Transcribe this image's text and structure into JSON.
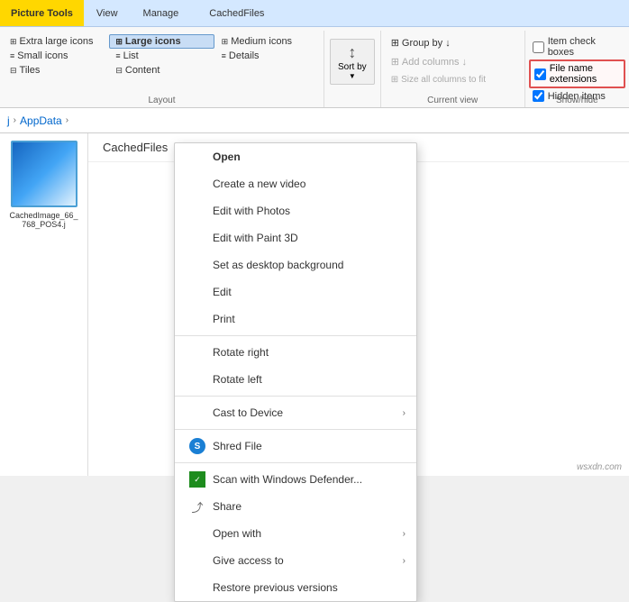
{
  "titleBar": {
    "pictureTools": "Picture Tools",
    "tabs": [
      "View",
      "Manage"
    ],
    "cachedFiles": "CachedFiles"
  },
  "ribbon": {
    "layout": {
      "label": "Layout",
      "items": [
        {
          "id": "extra-large",
          "label": "Extra large icons",
          "active": false
        },
        {
          "id": "large-icons",
          "label": "Large icons",
          "active": true
        },
        {
          "id": "medium-icons",
          "label": "Medium icons",
          "active": false
        },
        {
          "id": "small-icons",
          "label": "Small icons",
          "active": false
        },
        {
          "id": "list",
          "label": "List",
          "active": false
        },
        {
          "id": "details",
          "label": "Details",
          "active": false
        },
        {
          "id": "tiles",
          "label": "Tiles",
          "active": false
        },
        {
          "id": "content",
          "label": "Content",
          "active": false
        }
      ]
    },
    "currentView": {
      "label": "Current view",
      "sortBy": "Sort by",
      "groupBy": "Group by ↓",
      "addColumns": "Add columns ↓",
      "sizeAllColumns": "Size all columns to fit"
    },
    "showHide": {
      "label": "Show/hide",
      "itemCheckBoxes": "Item check boxes",
      "fileNameExtensions": "File name extensions",
      "hiddenItems": "Hidden items",
      "itemCheckBoxesChecked": false,
      "fileNameExtensionsChecked": true,
      "hiddenItemsChecked": true
    }
  },
  "addressBar": {
    "parts": [
      "j",
      "AppData"
    ]
  },
  "mainArea": {
    "rightHeader": "CachedFiles",
    "fileName": "CachedImage_66_768_POS4.j"
  },
  "contextMenu": {
    "items": [
      {
        "id": "open",
        "label": "Open",
        "icon": "none",
        "bold": true,
        "hasArrow": false
      },
      {
        "id": "create-video",
        "label": "Create a new video",
        "icon": "none",
        "hasArrow": false
      },
      {
        "id": "edit-photos",
        "label": "Edit with Photos",
        "icon": "none",
        "hasArrow": false
      },
      {
        "id": "edit-paint3d",
        "label": "Edit with Paint 3D",
        "icon": "none",
        "hasArrow": false
      },
      {
        "id": "set-desktop",
        "label": "Set as desktop background",
        "icon": "none",
        "hasArrow": false
      },
      {
        "id": "edit",
        "label": "Edit",
        "icon": "none",
        "hasArrow": false
      },
      {
        "id": "print",
        "label": "Print",
        "icon": "none",
        "hasArrow": false
      },
      {
        "id": "sep1",
        "type": "separator"
      },
      {
        "id": "rotate-right",
        "label": "Rotate right",
        "icon": "none",
        "hasArrow": false
      },
      {
        "id": "rotate-left",
        "label": "Rotate left",
        "icon": "none",
        "hasArrow": false
      },
      {
        "id": "sep2",
        "type": "separator"
      },
      {
        "id": "cast-device",
        "label": "Cast to Device",
        "icon": "none",
        "hasArrow": true
      },
      {
        "id": "sep3",
        "type": "separator"
      },
      {
        "id": "shred-file",
        "label": "Shred File",
        "icon": "circle",
        "hasArrow": false
      },
      {
        "id": "sep4",
        "type": "separator"
      },
      {
        "id": "scan-defender",
        "label": "Scan with Windows Defender...",
        "icon": "square",
        "hasArrow": false
      },
      {
        "id": "share",
        "label": "Share",
        "icon": "share",
        "hasArrow": false
      },
      {
        "id": "open-with",
        "label": "Open with",
        "icon": "none",
        "hasArrow": true
      },
      {
        "id": "give-access",
        "label": "Give access to",
        "icon": "none",
        "hasArrow": true
      },
      {
        "id": "restore-prev",
        "label": "Restore previous versions",
        "icon": "none",
        "hasArrow": false
      }
    ]
  },
  "watermark": "wsxdn.com"
}
